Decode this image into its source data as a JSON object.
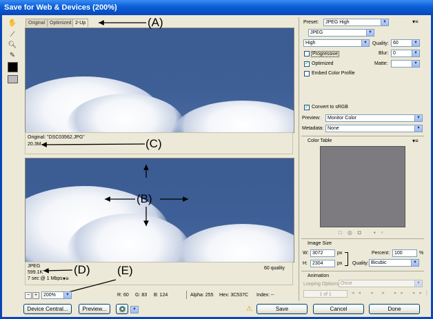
{
  "window": {
    "title": "Save for Web & Devices (200%)"
  },
  "tabs": [
    {
      "label": "Original"
    },
    {
      "label": "Optimized"
    },
    {
      "label": "2-Up"
    }
  ],
  "original_info": {
    "name": "Original: \"DSC03562.JPG\"",
    "size": "20.3M"
  },
  "optimized_info": {
    "format": "JPEG",
    "size": "599.1K",
    "time": "7 sec @ 1 Mbps",
    "quality": "60 quality"
  },
  "status": {
    "zoom": "200%",
    "r": "R: 60",
    "g": "G: 83",
    "b": "B: 124",
    "alpha": "Alpha: 255",
    "hex": "Hex: 3C537C",
    "index": "Index: --"
  },
  "annotations": {
    "a": "(A)",
    "b": "(B)",
    "c": "(C)",
    "d": "(D)",
    "e": "(E)"
  },
  "settings": {
    "preset_label": "Preset:",
    "preset_value": "JPEG High",
    "format_value": "JPEG",
    "quality_level": "High",
    "quality_label": "Quality:",
    "quality_value": "60",
    "progressive_label": "Progressive",
    "blur_label": "Blur:",
    "blur_value": "0",
    "optimized_label": "Optimized",
    "matte_label": "Matte:",
    "embed_label": "Embed Color Profile",
    "convert_label": "Convert to sRGB",
    "preview_label": "Preview:",
    "preview_value": "Monitor Color",
    "metadata_label": "Metadata:",
    "metadata_value": "None"
  },
  "color_table": {
    "title": "Color Table"
  },
  "image_size": {
    "title": "Image Size",
    "w_label": "W:",
    "w_value": "3072",
    "h_label": "H:",
    "h_value": "2304",
    "px": "px",
    "percent_label": "Percent:",
    "percent_value": "100",
    "percent_unit": "%",
    "quality_label": "Quality:",
    "quality_value": "Bicubic"
  },
  "animation": {
    "title": "Animation",
    "looping_label": "Looping Options:",
    "looping_value": "Once",
    "frame": "1 of 1"
  },
  "buttons": {
    "device_central": "Device Central...",
    "preview": "Preview...",
    "save": "Save",
    "cancel": "Cancel",
    "done": "Done"
  },
  "colors": {
    "title_bar": "#0a5fd8",
    "sky": "#3C537C",
    "panel": "#ece9d8"
  }
}
